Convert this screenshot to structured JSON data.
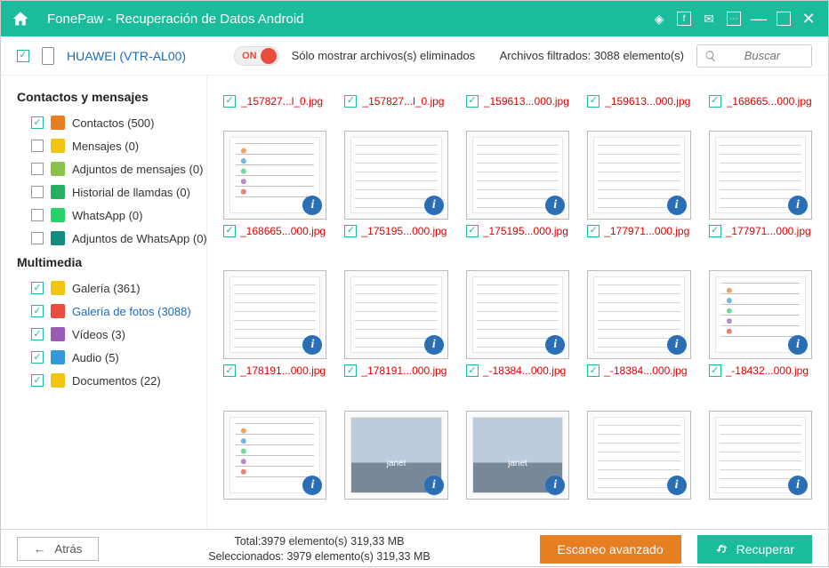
{
  "title": "FonePaw - Recuperación de Datos Android",
  "device": "HUAWEI (VTR-AL00)",
  "toggle": {
    "on": "ON",
    "label": "Sólo mostrar archivos(s) eliminados"
  },
  "filtered": "Archivos filtrados: 3088 elemento(s)",
  "search": {
    "placeholder": "Buscar"
  },
  "sidebar": {
    "cat1": "Contactos y mensajes",
    "cat2": "Multimedia",
    "items1": [
      {
        "label": "Contactos (500)",
        "checked": true,
        "color": "#e67e22"
      },
      {
        "label": "Mensajes (0)",
        "checked": false,
        "color": "#f1c40f"
      },
      {
        "label": "Adjuntos de mensajes (0)",
        "checked": false,
        "color": "#8bc34a"
      },
      {
        "label": "Historial de llamdas (0)",
        "checked": false,
        "color": "#27ae60"
      },
      {
        "label": "WhatsApp (0)",
        "checked": false,
        "color": "#25d366"
      },
      {
        "label": "Adjuntos de WhatsApp (0)",
        "checked": false,
        "color": "#128c7e"
      }
    ],
    "items2": [
      {
        "label": "Galería (361)",
        "checked": true,
        "color": "#f1c40f",
        "sel": false
      },
      {
        "label": "Galería de fotos (3088)",
        "checked": true,
        "color": "#e74c3c",
        "sel": true
      },
      {
        "label": "Vídeos (3)",
        "checked": true,
        "color": "#9b59b6",
        "sel": false
      },
      {
        "label": "Audio (5)",
        "checked": true,
        "color": "#3498db",
        "sel": false
      },
      {
        "label": "Documentos (22)",
        "checked": true,
        "color": "#f1c40f",
        "sel": false
      }
    ]
  },
  "grid": {
    "row0": [
      "_157827...l_0.jpg",
      "_157827...l_0.jpg",
      "_159613...000.jpg",
      "_159613...000.jpg",
      "_168665...000.jpg"
    ],
    "row1": [
      {
        "fn": "_168665...000.jpg",
        "style": "icons"
      },
      {
        "fn": "_175195...000.jpg",
        "style": "list"
      },
      {
        "fn": "_175195...000.jpg",
        "style": "list"
      },
      {
        "fn": "_177971...000.jpg",
        "style": "list"
      },
      {
        "fn": "_177971...000.jpg",
        "style": "list"
      }
    ],
    "row2": [
      {
        "fn": "_178191...000.jpg",
        "style": "list"
      },
      {
        "fn": "_178191...000.jpg",
        "style": "list"
      },
      {
        "fn": "_-18384...000.jpg",
        "style": "list"
      },
      {
        "fn": "_-18384...000.jpg",
        "style": "list"
      },
      {
        "fn": "_-18432...000.jpg",
        "style": "icons"
      }
    ],
    "row3": [
      {
        "fn": "",
        "style": "icons"
      },
      {
        "fn": "",
        "style": "mountains"
      },
      {
        "fn": "",
        "style": "mountains"
      },
      {
        "fn": "",
        "style": "list"
      },
      {
        "fn": "",
        "style": "list"
      }
    ]
  },
  "footer": {
    "back": "Atrás",
    "total": "Total:3979 elemento(s) 319,33 MB",
    "selected": "Seleccionados: 3979 elemento(s) 319,33 MB",
    "scan": "Escaneo avanzado",
    "recover": "Recuperar"
  }
}
